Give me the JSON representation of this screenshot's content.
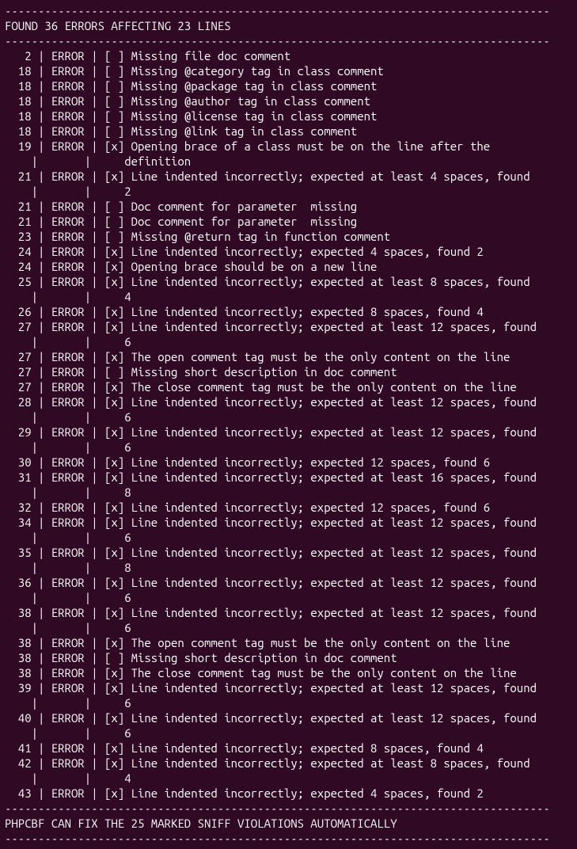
{
  "dash_line": "----------------------------------------------------------------------------------",
  "header": "FOUND 36 ERRORS AFFECTING 23 LINES",
  "footer": "PHPCBF CAN FIX THE 25 MARKED SNIFF VIOLATIONS AUTOMATICALLY",
  "rows": [
    {
      "line": "2",
      "type": "ERROR",
      "fix": false,
      "msg": [
        "Missing file doc comment"
      ]
    },
    {
      "line": "18",
      "type": "ERROR",
      "fix": false,
      "msg": [
        "Missing @category tag in class comment"
      ]
    },
    {
      "line": "18",
      "type": "ERROR",
      "fix": false,
      "msg": [
        "Missing @package tag in class comment"
      ]
    },
    {
      "line": "18",
      "type": "ERROR",
      "fix": false,
      "msg": [
        "Missing @author tag in class comment"
      ]
    },
    {
      "line": "18",
      "type": "ERROR",
      "fix": false,
      "msg": [
        "Missing @license tag in class comment"
      ]
    },
    {
      "line": "18",
      "type": "ERROR",
      "fix": false,
      "msg": [
        "Missing @link tag in class comment"
      ]
    },
    {
      "line": "19",
      "type": "ERROR",
      "fix": true,
      "msg": [
        "Opening brace of a class must be on the line after the",
        "definition"
      ]
    },
    {
      "line": "21",
      "type": "ERROR",
      "fix": true,
      "msg": [
        "Line indented incorrectly; expected at least 4 spaces, found",
        "2"
      ]
    },
    {
      "line": "21",
      "type": "ERROR",
      "fix": false,
      "msg": [
        "Doc comment for parameter  missing"
      ]
    },
    {
      "line": "21",
      "type": "ERROR",
      "fix": false,
      "msg": [
        "Doc comment for parameter  missing"
      ]
    },
    {
      "line": "23",
      "type": "ERROR",
      "fix": false,
      "msg": [
        "Missing @return tag in function comment"
      ]
    },
    {
      "line": "24",
      "type": "ERROR",
      "fix": true,
      "msg": [
        "Line indented incorrectly; expected 4 spaces, found 2"
      ]
    },
    {
      "line": "24",
      "type": "ERROR",
      "fix": true,
      "msg": [
        "Opening brace should be on a new line"
      ]
    },
    {
      "line": "25",
      "type": "ERROR",
      "fix": true,
      "msg": [
        "Line indented incorrectly; expected at least 8 spaces, found",
        "4"
      ]
    },
    {
      "line": "26",
      "type": "ERROR",
      "fix": true,
      "msg": [
        "Line indented incorrectly; expected 8 spaces, found 4"
      ]
    },
    {
      "line": "27",
      "type": "ERROR",
      "fix": true,
      "msg": [
        "Line indented incorrectly; expected at least 12 spaces, found",
        "6"
      ]
    },
    {
      "line": "27",
      "type": "ERROR",
      "fix": true,
      "msg": [
        "The open comment tag must be the only content on the line"
      ]
    },
    {
      "line": "27",
      "type": "ERROR",
      "fix": false,
      "msg": [
        "Missing short description in doc comment"
      ]
    },
    {
      "line": "27",
      "type": "ERROR",
      "fix": true,
      "msg": [
        "The close comment tag must be the only content on the line"
      ]
    },
    {
      "line": "28",
      "type": "ERROR",
      "fix": true,
      "msg": [
        "Line indented incorrectly; expected at least 12 spaces, found",
        "6"
      ]
    },
    {
      "line": "29",
      "type": "ERROR",
      "fix": true,
      "msg": [
        "Line indented incorrectly; expected at least 12 spaces, found",
        "6"
      ]
    },
    {
      "line": "30",
      "type": "ERROR",
      "fix": true,
      "msg": [
        "Line indented incorrectly; expected 12 spaces, found 6"
      ]
    },
    {
      "line": "31",
      "type": "ERROR",
      "fix": true,
      "msg": [
        "Line indented incorrectly; expected at least 16 spaces, found",
        "8"
      ]
    },
    {
      "line": "32",
      "type": "ERROR",
      "fix": true,
      "msg": [
        "Line indented incorrectly; expected 12 spaces, found 6"
      ]
    },
    {
      "line": "34",
      "type": "ERROR",
      "fix": true,
      "msg": [
        "Line indented incorrectly; expected at least 12 spaces, found",
        "6"
      ]
    },
    {
      "line": "35",
      "type": "ERROR",
      "fix": true,
      "msg": [
        "Line indented incorrectly; expected at least 12 spaces, found",
        "8"
      ]
    },
    {
      "line": "36",
      "type": "ERROR",
      "fix": true,
      "msg": [
        "Line indented incorrectly; expected at least 12 spaces, found",
        "6"
      ]
    },
    {
      "line": "38",
      "type": "ERROR",
      "fix": true,
      "msg": [
        "Line indented incorrectly; expected at least 12 spaces, found",
        "6"
      ]
    },
    {
      "line": "38",
      "type": "ERROR",
      "fix": true,
      "msg": [
        "The open comment tag must be the only content on the line"
      ]
    },
    {
      "line": "38",
      "type": "ERROR",
      "fix": false,
      "msg": [
        "Missing short description in doc comment"
      ]
    },
    {
      "line": "38",
      "type": "ERROR",
      "fix": true,
      "msg": [
        "The close comment tag must be the only content on the line"
      ]
    },
    {
      "line": "39",
      "type": "ERROR",
      "fix": true,
      "msg": [
        "Line indented incorrectly; expected at least 12 spaces, found",
        "6"
      ]
    },
    {
      "line": "40",
      "type": "ERROR",
      "fix": true,
      "msg": [
        "Line indented incorrectly; expected at least 12 spaces, found",
        "6"
      ]
    },
    {
      "line": "41",
      "type": "ERROR",
      "fix": true,
      "msg": [
        "Line indented incorrectly; expected 8 spaces, found 4"
      ]
    },
    {
      "line": "42",
      "type": "ERROR",
      "fix": true,
      "msg": [
        "Line indented incorrectly; expected at least 8 spaces, found",
        "4"
      ]
    },
    {
      "line": "43",
      "type": "ERROR",
      "fix": true,
      "msg": [
        "Line indented incorrectly; expected 4 spaces, found 2"
      ]
    }
  ]
}
